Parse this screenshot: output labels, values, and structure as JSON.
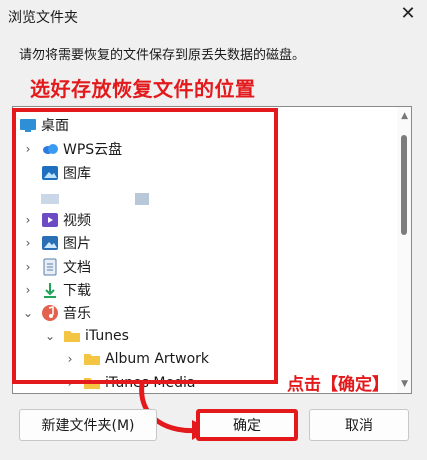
{
  "window": {
    "title": "浏览文件夹",
    "close_glyph": "✕"
  },
  "instruction": "请勿将需要恢复的文件保存到原丢失数据的磁盘。",
  "annotations": {
    "top": "选好存放恢复文件的位置",
    "bottom": "点击【确定】",
    "color": "#e3191b"
  },
  "tree": {
    "items": [
      {
        "label": "桌面",
        "icon": "desktop-icon",
        "expander": "none"
      },
      {
        "label": "WPS云盘",
        "icon": "cloud-icon",
        "expander": "collapsed"
      },
      {
        "label": "图库",
        "icon": "gallery-icon",
        "expander": "none"
      },
      {
        "label": "",
        "icon": "blurred-icon",
        "expander": "none"
      },
      {
        "label": "视频",
        "icon": "video-icon",
        "expander": "collapsed"
      },
      {
        "label": "图片",
        "icon": "pictures-icon",
        "expander": "collapsed"
      },
      {
        "label": "文档",
        "icon": "documents-icon",
        "expander": "collapsed"
      },
      {
        "label": "下载",
        "icon": "download-icon",
        "expander": "collapsed"
      },
      {
        "label": "音乐",
        "icon": "music-icon",
        "expander": "expanded"
      },
      {
        "label": "iTunes",
        "icon": "folder-icon",
        "expander": "expanded"
      },
      {
        "label": "Album Artwork",
        "icon": "folder-icon",
        "expander": "collapsed"
      },
      {
        "label": "iTunes Media",
        "icon": "folder-icon",
        "expander": "collapsed"
      }
    ]
  },
  "buttons": {
    "new_folder": "新建文件夹(M)",
    "ok": "确定",
    "cancel": "取消"
  }
}
